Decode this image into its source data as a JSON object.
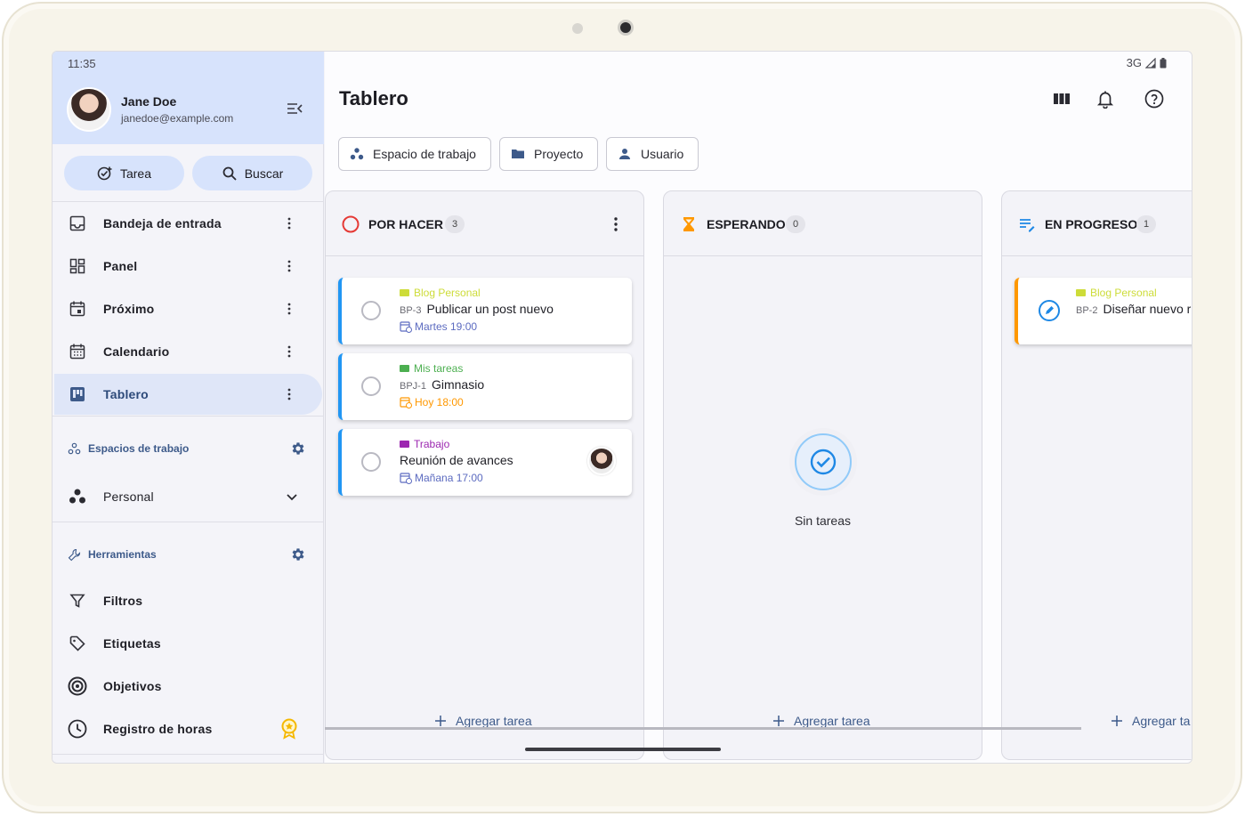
{
  "status": {
    "time": "11:35",
    "network": "3G"
  },
  "user": {
    "name": "Jane Doe",
    "email": "janedoe@example.com"
  },
  "actions": {
    "task_label": "Tarea",
    "search_label": "Buscar"
  },
  "nav": {
    "items": [
      {
        "label": "Bandeja de entrada",
        "icon": "inbox-icon"
      },
      {
        "label": "Panel",
        "icon": "dashboard-icon"
      },
      {
        "label": "Próximo",
        "icon": "calendar-today-icon"
      },
      {
        "label": "Calendario",
        "icon": "calendar-month-icon"
      },
      {
        "label": "Tablero",
        "icon": "board-icon",
        "active": true
      }
    ]
  },
  "workspaces": {
    "title": "Espacios de trabajo",
    "current": "Personal"
  },
  "tools": {
    "title": "Herramientas",
    "items": [
      {
        "label": "Filtros",
        "icon": "filter-icon"
      },
      {
        "label": "Etiquetas",
        "icon": "tag-icon"
      },
      {
        "label": "Objetivos",
        "icon": "target-icon"
      },
      {
        "label": "Registro de horas",
        "icon": "clock-icon"
      }
    ]
  },
  "main": {
    "title": "Tablero",
    "filters": {
      "workspace": "Espacio de trabajo",
      "project": "Proyecto",
      "user": "Usuario"
    }
  },
  "columns": [
    {
      "title": "POR HACER",
      "count": "3",
      "icon": "circle-outline-icon",
      "add_label": "Agregar tarea",
      "cards": [
        {
          "project": "Blog Personal",
          "project_color": "#cddc39",
          "code": "BP-3",
          "title": "Publicar un post nuevo",
          "due": "Martes 19:00",
          "due_color": "#5c6bc0"
        },
        {
          "project": "Mis tareas",
          "project_color": "#4caf50",
          "code": "BPJ-1",
          "title": "Gimnasio",
          "due": "Hoy 18:00",
          "due_color": "#ff9800"
        },
        {
          "project": "Trabajo",
          "project_color": "#9c27b0",
          "code": "",
          "title": "Reunión de avances",
          "due": "Mañana 17:00",
          "due_color": "#5c6bc0"
        }
      ]
    },
    {
      "title": "ESPERANDO",
      "count": "0",
      "icon": "hourglass-icon",
      "empty_label": "Sin tareas",
      "add_label": "Agregar tarea"
    },
    {
      "title": "EN PROGRESO",
      "count": "1",
      "icon": "progress-list-icon",
      "add_label": "Agregar ta",
      "cards": [
        {
          "project": "Blog Personal",
          "project_color": "#cddc39",
          "code": "BP-2",
          "title": "Diseñar nuevo r"
        }
      ]
    }
  ]
}
